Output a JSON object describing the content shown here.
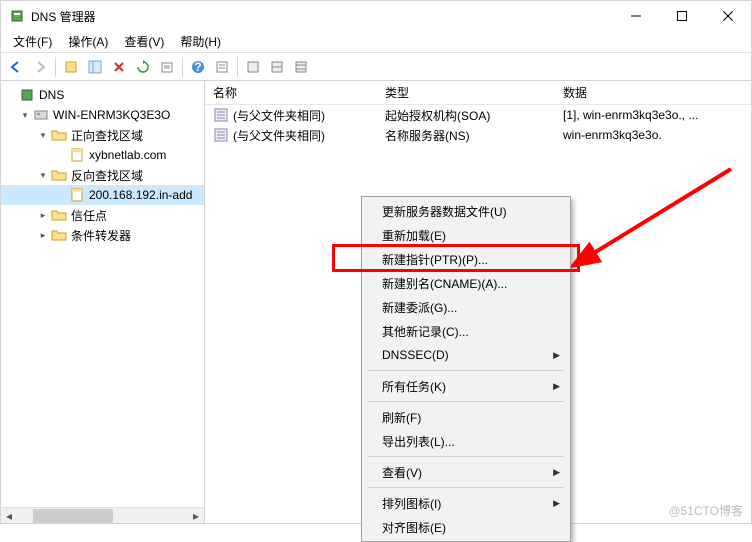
{
  "window": {
    "title": "DNS 管理器"
  },
  "menus": {
    "file": "文件(F)",
    "action": "操作(A)",
    "view": "查看(V)",
    "help": "帮助(H)"
  },
  "tree": {
    "root": "DNS",
    "server": "WIN-ENRM3KQ3E3O",
    "fwd_zone": "正向查找区域",
    "fwd_domain": "xybnetlab.com",
    "rev_zone": "反向查找区域",
    "rev_entry": "200.168.192.in-add",
    "trust": "信任点",
    "cond": "条件转发器"
  },
  "columns": {
    "name": "名称",
    "type": "类型",
    "data": "数据"
  },
  "rows": [
    {
      "name": "(与父文件夹相同)",
      "type": "起始授权机构(SOA)",
      "data": "[1], win-enrm3kq3e3o., ..."
    },
    {
      "name": "(与父文件夹相同)",
      "type": "名称服务器(NS)",
      "data": "win-enrm3kq3e3o."
    }
  ],
  "ctx": {
    "update": "更新服务器数据文件(U)",
    "reload": "重新加载(E)",
    "ptr": "新建指针(PTR)(P)...",
    "cname": "新建别名(CNAME)(A)...",
    "delegation": "新建委派(G)...",
    "other": "其他新记录(C)...",
    "dnssec": "DNSSEC(D)",
    "alltasks": "所有任务(K)",
    "refresh": "刷新(F)",
    "export": "导出列表(L)...",
    "view": "查看(V)",
    "arrange": "排列图标(I)",
    "align": "对齐图标(E)"
  },
  "watermark": "@51CTO博客"
}
